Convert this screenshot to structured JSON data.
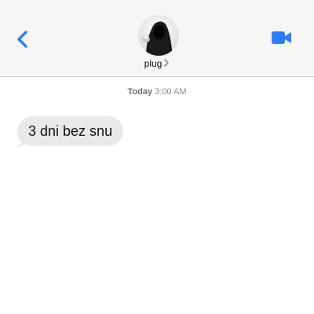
{
  "header": {
    "contact_name": "plug",
    "icons": {
      "back": "chevron-left-icon",
      "video": "video-camera-icon",
      "disclosure": "chevron-right-icon"
    },
    "accent_color": "#2d7cf6"
  },
  "thread": {
    "timestamp_day": "Today",
    "timestamp_time": "3:00 AM",
    "messages": [
      {
        "direction": "incoming",
        "text": "3 dni bez snu"
      }
    ]
  }
}
